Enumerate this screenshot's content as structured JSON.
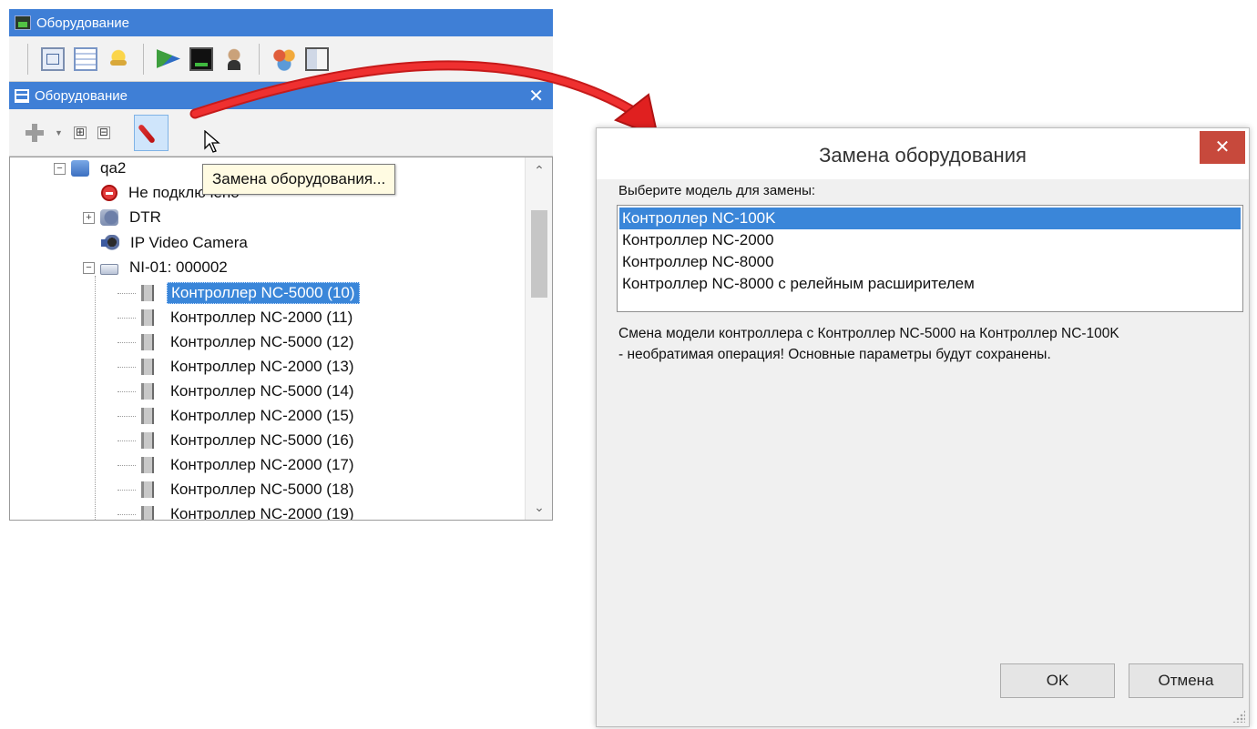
{
  "outer_window": {
    "title": "Оборудование"
  },
  "panel": {
    "title": "Оборудование",
    "close_glyph": "✕",
    "expand_glyph": "⊞",
    "collapse_glyph": "⊟"
  },
  "tooltip": {
    "text": "Замена оборудования..."
  },
  "tree": {
    "root": {
      "label": "qa2",
      "expander": "−"
    },
    "items": [
      {
        "label": "Не подключено",
        "expander": ""
      },
      {
        "label": "DTR",
        "expander": "+"
      },
      {
        "label": "IP Video Camera",
        "expander": ""
      },
      {
        "label": "NI-01: 000002",
        "expander": "−"
      }
    ],
    "controllers": [
      "Контроллер NC-5000 (10)",
      "Контроллер NC-2000 (11)",
      "Контроллер NC-5000 (12)",
      "Контроллер NC-2000 (13)",
      "Контроллер NC-5000 (14)",
      "Контроллер NC-2000 (15)",
      "Контроллер NC-5000 (16)",
      "Контроллер NC-2000 (17)",
      "Контроллер NC-5000 (18)",
      "Контроллер NC-2000 (19)"
    ],
    "selected_index": 0,
    "scroll_up": "⌃",
    "scroll_down": "⌄"
  },
  "dialog": {
    "title": "Замена оборудования",
    "close_glyph": "✕",
    "prompt": "Выберите модель для замены:",
    "models": [
      "Контроллер NC-100K",
      "Контроллер NC-2000",
      "Контроллер NC-8000",
      "Контроллер NC-8000 с релейным расширителем"
    ],
    "selected_model_index": 0,
    "warning_line1": "Смена модели контроллера с Контроллер NC-5000 на Контроллер NC-100K",
    "warning_line2": "- необратимая операция! Основные параметры будут сохранены.",
    "ok_label": "OK",
    "cancel_label": "Отмена"
  },
  "colors": {
    "titlebar": "#3f7fd6",
    "selection": "#3a86d9",
    "arrow": "#e02020",
    "dialog_close": "#c7493c"
  }
}
